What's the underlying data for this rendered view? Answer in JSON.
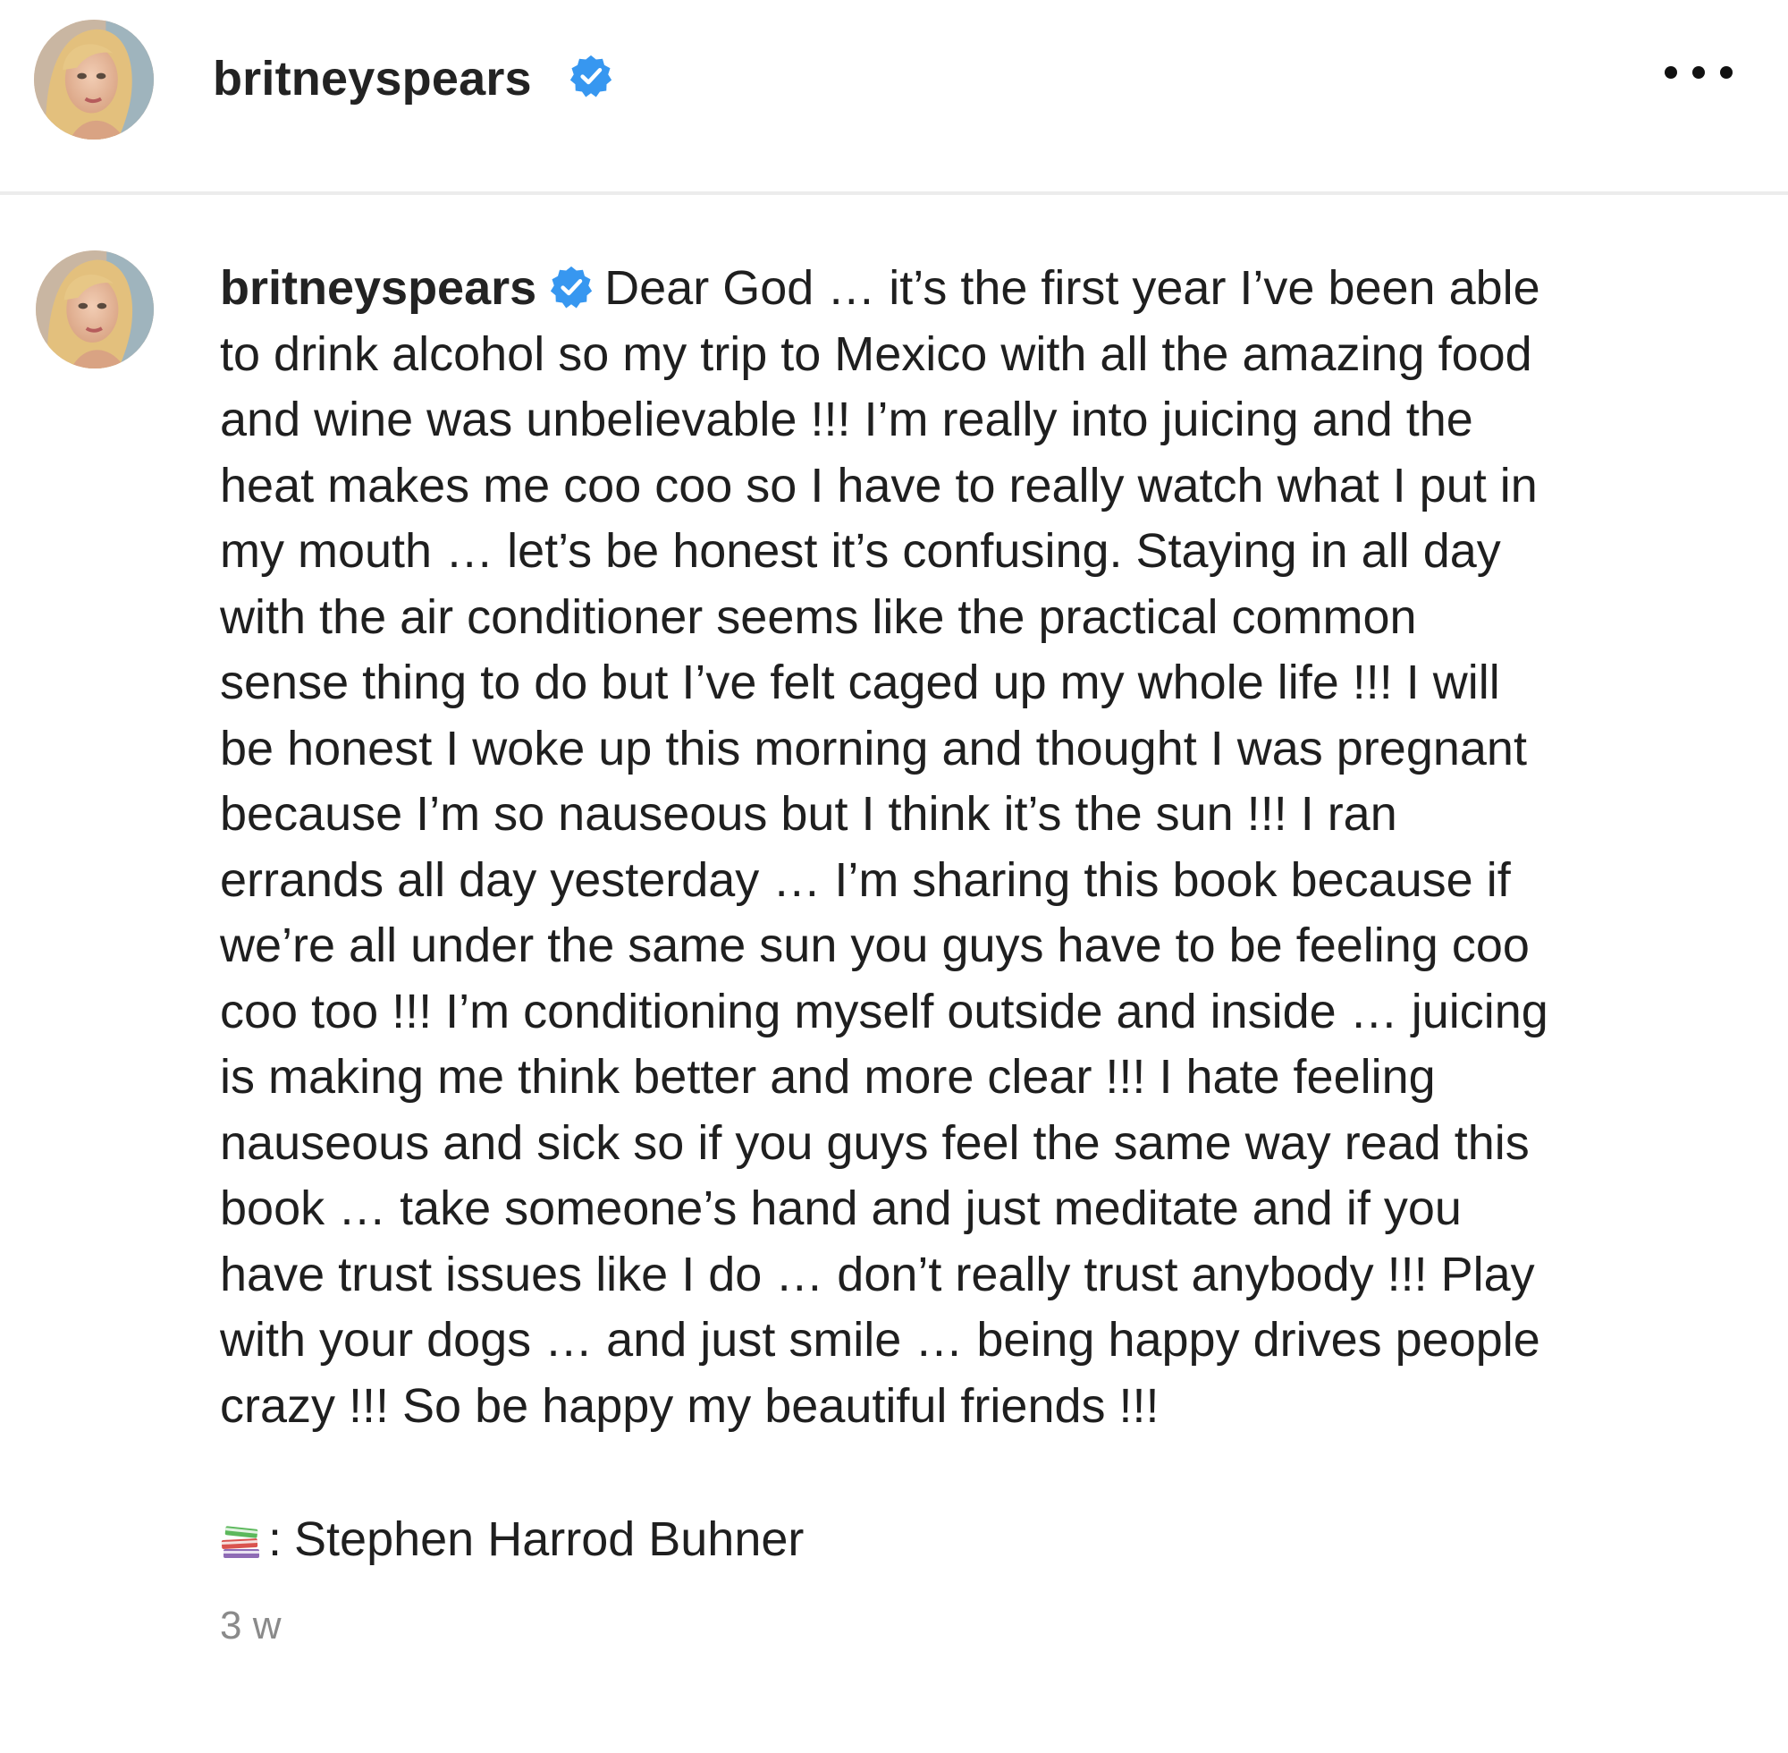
{
  "header": {
    "username": "britneyspears",
    "verified_icon": "verified-badge-icon",
    "more_icon": "more-options-icon"
  },
  "post": {
    "username": "britneyspears",
    "verified_icon": "verified-badge-icon",
    "caption": "Dear God … it’s the first year I’ve been able\nto drink alcohol so my trip to Mexico with all the amazing food\nand wine was unbelievable !!! I’m really into juicing and the\nheat makes me coo coo so I have to really watch what I put in\nmy mouth … let’s be honest it’s confusing. Staying in all day\nwith the air conditioner seems like the practical common\nsense thing to do but I’ve felt caged up my whole life !!! I will\nbe honest I woke up this morning and thought I was pregnant\nbecause I’m so nauseous but I think it’s the sun !!! I ran\nerrands all day yesterday … I’m sharing this book because if\nwe’re all under the same sun you guys have to be feeling coo\ncoo too !!! I’m conditioning myself outside and inside … juicing\nis making me think better and more clear !!! I hate feeling\nnauseous and sick so if you guys feel the same way read this\nbook … take someone’s hand and just meditate and if you\nhave trust issues like I do … don’t really trust anybody !!!  Play\nwith your dogs … and just smile … being happy drives people\ncrazy !!! So be happy my beautiful friends !!!",
    "credit_icon": "books-emoji-icon",
    "credit_separator": ":",
    "credit_author": "Stephen Harrod Buhner",
    "timestamp": "3 w"
  },
  "colors": {
    "verified_blue": "#3797f0",
    "text_primary": "#1f1f1f",
    "text_secondary": "#8a8a8a",
    "divider": "#ececec"
  }
}
